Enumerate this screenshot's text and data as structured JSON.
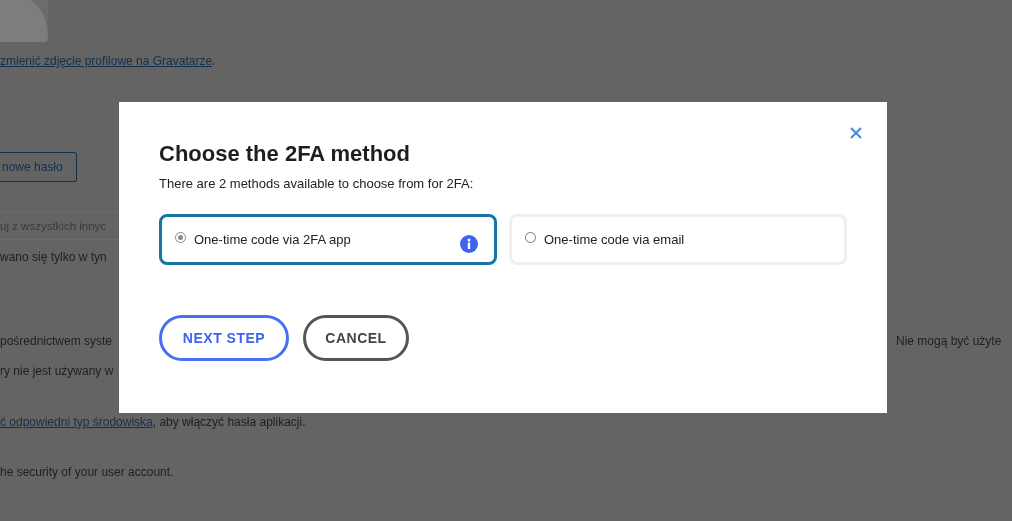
{
  "background_page": {
    "gravatar_link": "zmienić zdjęcie profilowe na Gravatarze",
    "gravatar_link_end": ".",
    "new_password_button": "nowe hasło",
    "sessions_field_placeholder": "uj z wszystkich innyc",
    "sessions_note": "wano się tylko w tyn",
    "app_passwords_line_left": "pośrednictwem syste",
    "app_passwords_line_right": "Nie mogą być użyte",
    "app_passwords_line_2": "ry nie jest używany w",
    "environment_link": "ć odpowiedni typ środowiska",
    "environment_text": ", aby włączyć hasła aplikacji.",
    "security_note": "he security of your user account."
  },
  "dialog": {
    "title": "Choose the 2FA method",
    "description": "There are 2 methods available to choose from for 2FA:",
    "options": [
      {
        "label": "One-time code via 2FA app",
        "selected": true,
        "info": true
      },
      {
        "label": "One-time code via email",
        "selected": false,
        "info": false
      }
    ],
    "buttons": [
      {
        "label": "NEXT STEP",
        "kind": "primary"
      },
      {
        "label": "CANCEL",
        "kind": "secondary"
      }
    ]
  }
}
